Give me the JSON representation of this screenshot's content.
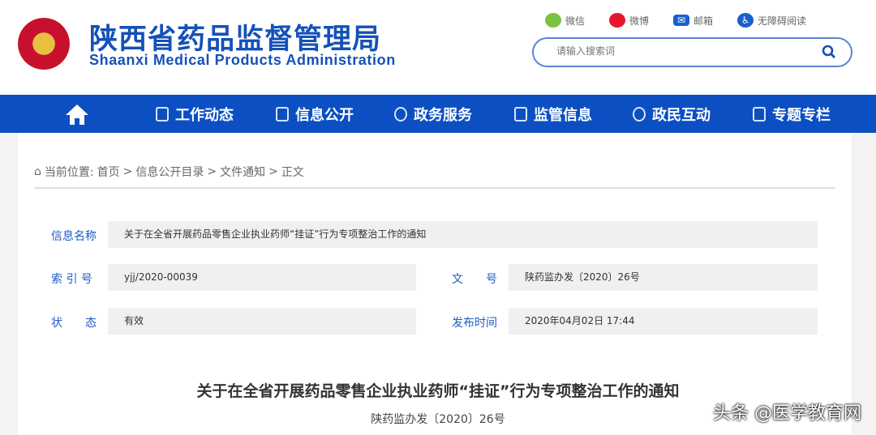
{
  "header": {
    "title_cn": "陕西省药品监督管理局",
    "title_en": "Shaanxi Medical Products Administration",
    "links": [
      {
        "label": "微信",
        "icon": "wechat-icon",
        "color": "#7bc342"
      },
      {
        "label": "微博",
        "icon": "weibo-icon",
        "color": "#e6162d"
      },
      {
        "label": "邮箱",
        "icon": "mail-icon",
        "color": "#1a5fd0"
      },
      {
        "label": "无障碍阅读",
        "icon": "accessibility-icon",
        "color": "#1a5fd0"
      }
    ],
    "search_placeholder": "请输入搜索词"
  },
  "nav": {
    "items": [
      "工作动态",
      "信息公开",
      "政务服务",
      "监管信息",
      "政民互动",
      "专题专栏"
    ]
  },
  "breadcrumb": {
    "prefix": "当前位置:",
    "items": [
      "首页",
      "信息公开目录",
      "文件通知",
      "正文"
    ],
    "sep": ">"
  },
  "meta": {
    "name_label": "信息名称",
    "name_value": "关于在全省开展药品零售企业执业药师“挂证”行为专项整治工作的通知",
    "index_label": "索 引 号",
    "index_value": "yjj/2020-00039",
    "docno_label": "文　　号",
    "docno_value": "陕药监办发〔2020〕26号",
    "status_label": "状　　态",
    "status_value": "有效",
    "date_label": "发布时间",
    "date_value": "2020年04月02日 17:44"
  },
  "article": {
    "title": "关于在全省开展药品零售企业执业药师“挂证”行为专项整治工作的通知",
    "doc_no": "陕药监办发〔2020〕26号"
  },
  "watermark": "头条 @医学教育网"
}
